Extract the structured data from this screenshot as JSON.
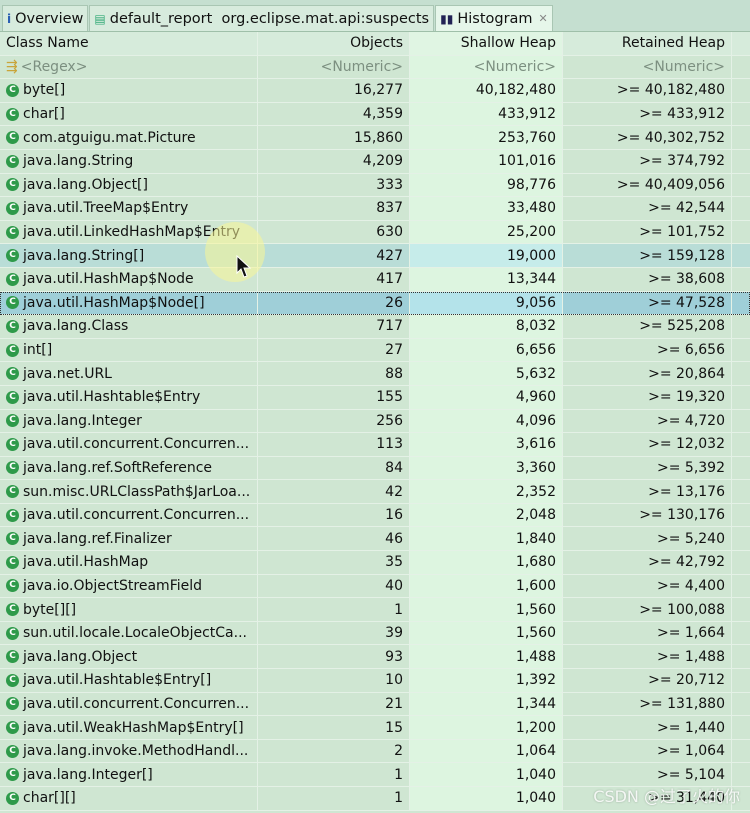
{
  "tabs": [
    {
      "label": "Overview",
      "icon": "info-icon"
    },
    {
      "label": "default_report  org.eclipse.mat.api:suspects",
      "icon": "report-icon"
    },
    {
      "label": "Histogram",
      "icon": "histogram-icon",
      "active": true
    }
  ],
  "columns": [
    "Class Name",
    "Objects",
    "Shallow Heap",
    "Retained Heap"
  ],
  "filter": [
    "<Regex>",
    "<Numeric>",
    "<Numeric>",
    "<Numeric>"
  ],
  "rows": [
    [
      "byte[]",
      "16,277",
      "40,182,480",
      ">= 40,182,480"
    ],
    [
      "char[]",
      "4,359",
      "433,912",
      ">= 433,912"
    ],
    [
      "com.atguigu.mat.Picture",
      "15,860",
      "253,760",
      ">= 40,302,752"
    ],
    [
      "java.lang.String",
      "4,209",
      "101,016",
      ">= 374,792"
    ],
    [
      "java.lang.Object[]",
      "333",
      "98,776",
      ">= 40,409,056"
    ],
    [
      "java.util.TreeMap$Entry",
      "837",
      "33,480",
      ">= 42,544"
    ],
    [
      "java.util.LinkedHashMap$Entry",
      "630",
      "25,200",
      ">= 101,752"
    ],
    [
      "java.lang.String[]",
      "427",
      "19,000",
      ">= 159,128"
    ],
    [
      "java.util.HashMap$Node",
      "417",
      "13,344",
      ">= 38,608"
    ],
    [
      "java.util.HashMap$Node[]",
      "26",
      "9,056",
      ">= 47,528"
    ],
    [
      "java.lang.Class",
      "717",
      "8,032",
      ">= 525,208"
    ],
    [
      "int[]",
      "27",
      "6,656",
      ">= 6,656"
    ],
    [
      "java.net.URL",
      "88",
      "5,632",
      ">= 20,864"
    ],
    [
      "java.util.Hashtable$Entry",
      "155",
      "4,960",
      ">= 19,320"
    ],
    [
      "java.lang.Integer",
      "256",
      "4,096",
      ">= 4,720"
    ],
    [
      "java.util.concurrent.Concurren...",
      "113",
      "3,616",
      ">= 12,032"
    ],
    [
      "java.lang.ref.SoftReference",
      "84",
      "3,360",
      ">= 5,392"
    ],
    [
      "sun.misc.URLClassPath$JarLoa...",
      "42",
      "2,352",
      ">= 13,176"
    ],
    [
      "java.util.concurrent.Concurren...",
      "16",
      "2,048",
      ">= 130,176"
    ],
    [
      "java.lang.ref.Finalizer",
      "46",
      "1,840",
      ">= 5,240"
    ],
    [
      "java.util.HashMap",
      "35",
      "1,680",
      ">= 42,792"
    ],
    [
      "java.io.ObjectStreamField",
      "40",
      "1,600",
      ">= 4,400"
    ],
    [
      "byte[][]",
      "1",
      "1,560",
      ">= 100,088"
    ],
    [
      "sun.util.locale.LocaleObjectCa...",
      "39",
      "1,560",
      ">= 1,664"
    ],
    [
      "java.lang.Object",
      "93",
      "1,488",
      ">= 1,488"
    ],
    [
      "java.util.Hashtable$Entry[]",
      "10",
      "1,392",
      ">= 20,712"
    ],
    [
      "java.util.concurrent.Concurren...",
      "21",
      "1,344",
      ">= 131,880"
    ],
    [
      "java.util.WeakHashMap$Entry[]",
      "15",
      "1,200",
      ">= 1,440"
    ],
    [
      "java.lang.invoke.MethodHandl...",
      "2",
      "1,064",
      ">= 1,064"
    ],
    [
      "java.lang.Integer[]",
      "1",
      "1,040",
      ">= 5,104"
    ],
    [
      "char[][]",
      "1",
      "1,040",
      ">= 31,440"
    ]
  ],
  "hover_row": 7,
  "selected_row": 9,
  "watermark": "CSDN @过了火的你"
}
